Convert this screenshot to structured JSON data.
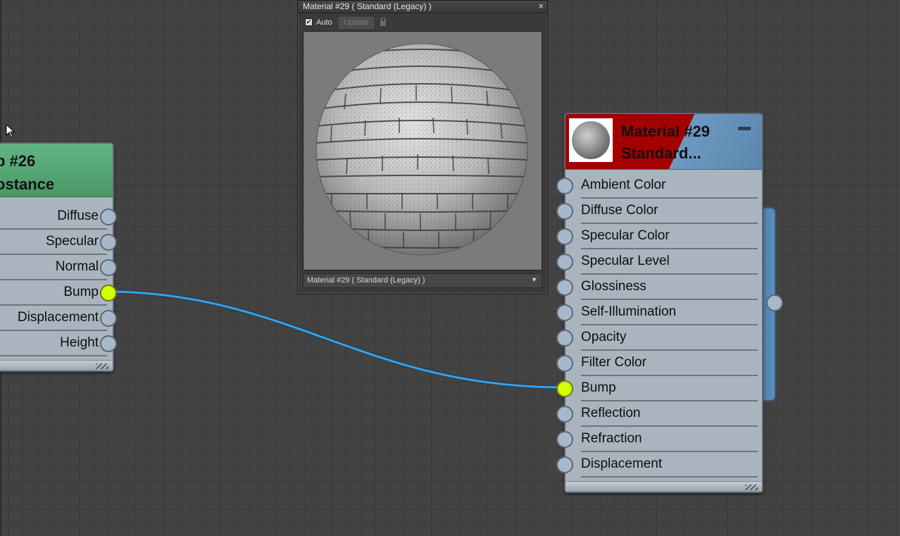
{
  "left_node": {
    "title_line1": "p #26",
    "title_line2": "ostance",
    "slots": [
      {
        "label": "Diffuse",
        "connected": false
      },
      {
        "label": "Specular",
        "connected": false
      },
      {
        "label": "Normal",
        "connected": false
      },
      {
        "label": "Bump",
        "connected": true
      },
      {
        "label": "Displacement",
        "connected": false
      },
      {
        "label": "Height",
        "connected": false
      }
    ]
  },
  "right_node": {
    "title_line1": "Material #29",
    "title_line2": "Standard...",
    "slots": [
      {
        "label": "Ambient Color",
        "connected": false
      },
      {
        "label": "Diffuse Color",
        "connected": false
      },
      {
        "label": "Specular Color",
        "connected": false
      },
      {
        "label": "Specular Level",
        "connected": false
      },
      {
        "label": "Glossiness",
        "connected": false
      },
      {
        "label": "Self-Illumination",
        "connected": false
      },
      {
        "label": "Opacity",
        "connected": false
      },
      {
        "label": "Filter Color",
        "connected": false
      },
      {
        "label": "Bump",
        "connected": true
      },
      {
        "label": "Reflection",
        "connected": false
      },
      {
        "label": "Refraction",
        "connected": false
      },
      {
        "label": "Displacement",
        "connected": false
      }
    ]
  },
  "preview_window": {
    "title": "Material #29  ( Standard (Legacy) )",
    "close_label": "×",
    "auto_checked": true,
    "auto_label": "Auto",
    "update_label": "Update",
    "dropdown_value": "Material #29  ( Standard (Legacy) )"
  },
  "colors": {
    "canvas": "#434343",
    "socket_active": "#d2ff00",
    "wire": "#39a2ea",
    "left_header": "#5aa87a",
    "right_header_red": "#a30000",
    "right_header_blue": "#6c9ac2"
  },
  "icons": [
    "check-icon",
    "lock-icon",
    "dropdown-arrow-icon",
    "close-icon",
    "mouse-cursor-icon",
    "minimize-icon",
    "resize-grip-icon"
  ]
}
